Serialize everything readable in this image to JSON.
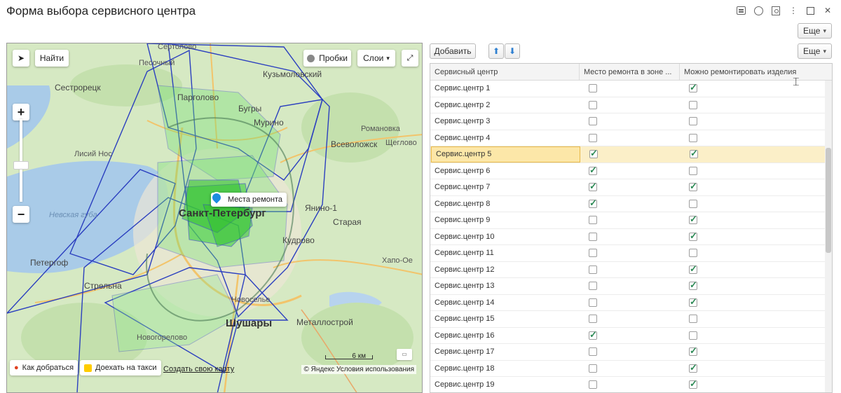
{
  "window": {
    "title": "Форма выбора сервисного центра",
    "more_label": "Еще"
  },
  "map": {
    "find_label": "Найти",
    "traffic_label": "Пробки",
    "layers_label": "Слои",
    "pin_label": "Места ремонта",
    "zoom_in": "+",
    "zoom_out": "−",
    "route_label": "Как добраться",
    "taxi_label": "Доехать на такси",
    "create_map_label": "Создать свою карту",
    "copyright": "© Яндекс Условия использования",
    "scale_label": "6 км",
    "places": [
      {
        "name": "Сертолово",
        "cls": ""
      },
      {
        "name": "Песочный",
        "cls": ""
      },
      {
        "name": "Кузьмоловский",
        "cls": "big"
      },
      {
        "name": "Сестрорецк",
        "cls": "big"
      },
      {
        "name": "Парголово",
        "cls": "big"
      },
      {
        "name": "Бугры",
        "cls": "big"
      },
      {
        "name": "Мурино",
        "cls": "big"
      },
      {
        "name": "Романовка",
        "cls": ""
      },
      {
        "name": "Всеволожск",
        "cls": "big"
      },
      {
        "name": "Щеглово",
        "cls": ""
      },
      {
        "name": "Лисий Нос",
        "cls": ""
      },
      {
        "name": "Санкт-Петербург",
        "cls": "city"
      },
      {
        "name": "Янино-1",
        "cls": "big"
      },
      {
        "name": "Старая",
        "cls": "big"
      },
      {
        "name": "Невская губа",
        "cls": "water"
      },
      {
        "name": "Кудрово",
        "cls": "big"
      },
      {
        "name": "Петергоф",
        "cls": "big"
      },
      {
        "name": "Хапо-Ое",
        "cls": ""
      },
      {
        "name": "Стрельна",
        "cls": "big"
      },
      {
        "name": "Шушары",
        "cls": "city"
      },
      {
        "name": "Металлострой",
        "cls": "big"
      },
      {
        "name": "Новоселье",
        "cls": ""
      },
      {
        "name": "Новогорелово",
        "cls": ""
      }
    ]
  },
  "toolbar": {
    "add_label": "Добавить",
    "up_icon": "arrow-up-icon",
    "down_icon": "arrow-down-icon",
    "more_label": "Еще"
  },
  "table": {
    "headers": [
      "Сервисный центр",
      "Место ремонта в зоне ...",
      "Можно ремонтировать изделия"
    ],
    "rows": [
      {
        "name": "Сервис.центр 1",
        "in_zone": false,
        "can_repair": true
      },
      {
        "name": "Сервис.центр 2",
        "in_zone": false,
        "can_repair": false
      },
      {
        "name": "Сервис.центр 3",
        "in_zone": false,
        "can_repair": false
      },
      {
        "name": "Сервис.центр 4",
        "in_zone": false,
        "can_repair": false
      },
      {
        "name": "Сервис.центр 5",
        "in_zone": true,
        "can_repair": true,
        "selected": true
      },
      {
        "name": "Сервис.центр 6",
        "in_zone": true,
        "can_repair": false
      },
      {
        "name": "Сервис.центр 7",
        "in_zone": true,
        "can_repair": true
      },
      {
        "name": "Сервис.центр 8",
        "in_zone": true,
        "can_repair": false
      },
      {
        "name": "Сервис.центр 9",
        "in_zone": false,
        "can_repair": true
      },
      {
        "name": "Сервис.центр 10",
        "in_zone": false,
        "can_repair": true
      },
      {
        "name": "Сервис.центр 11",
        "in_zone": false,
        "can_repair": false
      },
      {
        "name": "Сервис.центр 12",
        "in_zone": false,
        "can_repair": true
      },
      {
        "name": "Сервис.центр 13",
        "in_zone": false,
        "can_repair": true
      },
      {
        "name": "Сервис.центр 14",
        "in_zone": false,
        "can_repair": true
      },
      {
        "name": "Сервис.центр 15",
        "in_zone": false,
        "can_repair": false
      },
      {
        "name": "Сервис.центр 16",
        "in_zone": true,
        "can_repair": false
      },
      {
        "name": "Сервис.центр 17",
        "in_zone": false,
        "can_repair": true
      },
      {
        "name": "Сервис.центр 18",
        "in_zone": false,
        "can_repair": true
      },
      {
        "name": "Сервис.центр 19",
        "in_zone": false,
        "can_repair": true
      }
    ]
  },
  "colors": {
    "selected_row": "#fbefc8",
    "check": "#2e8b57",
    "zone_fill": "#5ed45e",
    "zone_stroke": "#2b3fbf",
    "water": "#a9cbe8"
  }
}
